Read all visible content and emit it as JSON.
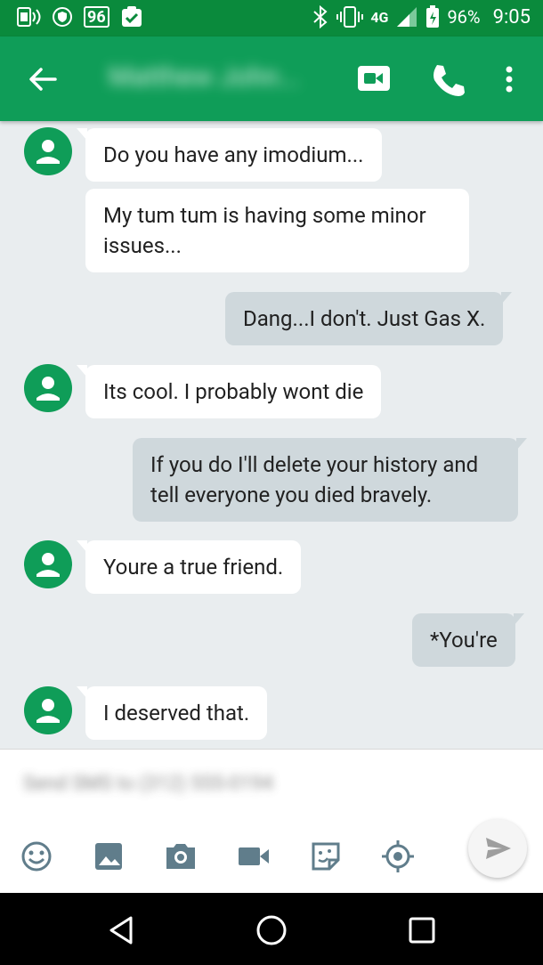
{
  "status_bar": {
    "badge_number": "96",
    "network": "4G",
    "battery": "96%",
    "time": "9:05",
    "icons": [
      "sim-icon",
      "shield-icon",
      "check-clipboard-icon",
      "bluetooth-icon",
      "vibrate-icon",
      "signal-icon",
      "battery-icon"
    ]
  },
  "app_bar": {
    "contact_name": "Matthew John...",
    "icons": [
      "back-arrow-icon",
      "video-call-icon",
      "phone-icon",
      "more-vert-icon"
    ]
  },
  "messages": [
    {
      "dir": "in",
      "text": "Do you have any imodium...",
      "avatar": true
    },
    {
      "dir": "in",
      "text": "My tum tum is having some minor issues...",
      "avatar": false
    },
    {
      "dir": "out",
      "text": "Dang...I don't. Just Gas X."
    },
    {
      "dir": "in",
      "text": "Its cool. I probably wont die",
      "avatar": true
    },
    {
      "dir": "out",
      "text": "If you do I'll delete your history and tell everyone you died bravely."
    },
    {
      "dir": "in",
      "text": "Youre a true friend.",
      "avatar": true
    },
    {
      "dir": "out",
      "text": "*You're"
    },
    {
      "dir": "in",
      "text": "I deserved that.",
      "avatar": true
    }
  ],
  "compose": {
    "placeholder": "Send SMS to (312) 555-0194",
    "icons": [
      "emoji-icon",
      "image-icon",
      "camera-icon",
      "video-icon",
      "sticker-icon",
      "location-icon",
      "send-icon"
    ]
  },
  "colors": {
    "status_bar": "#0a8a3c",
    "app_bar": "#0f9d58",
    "avatar": "#0f9d58",
    "thread_bg": "#e9edef",
    "incoming_bubble": "#ffffff",
    "outgoing_bubble": "#cfd8dc"
  },
  "nav_bar": {
    "icons": [
      "back-triangle-icon",
      "home-circle-icon",
      "recents-square-icon"
    ]
  }
}
